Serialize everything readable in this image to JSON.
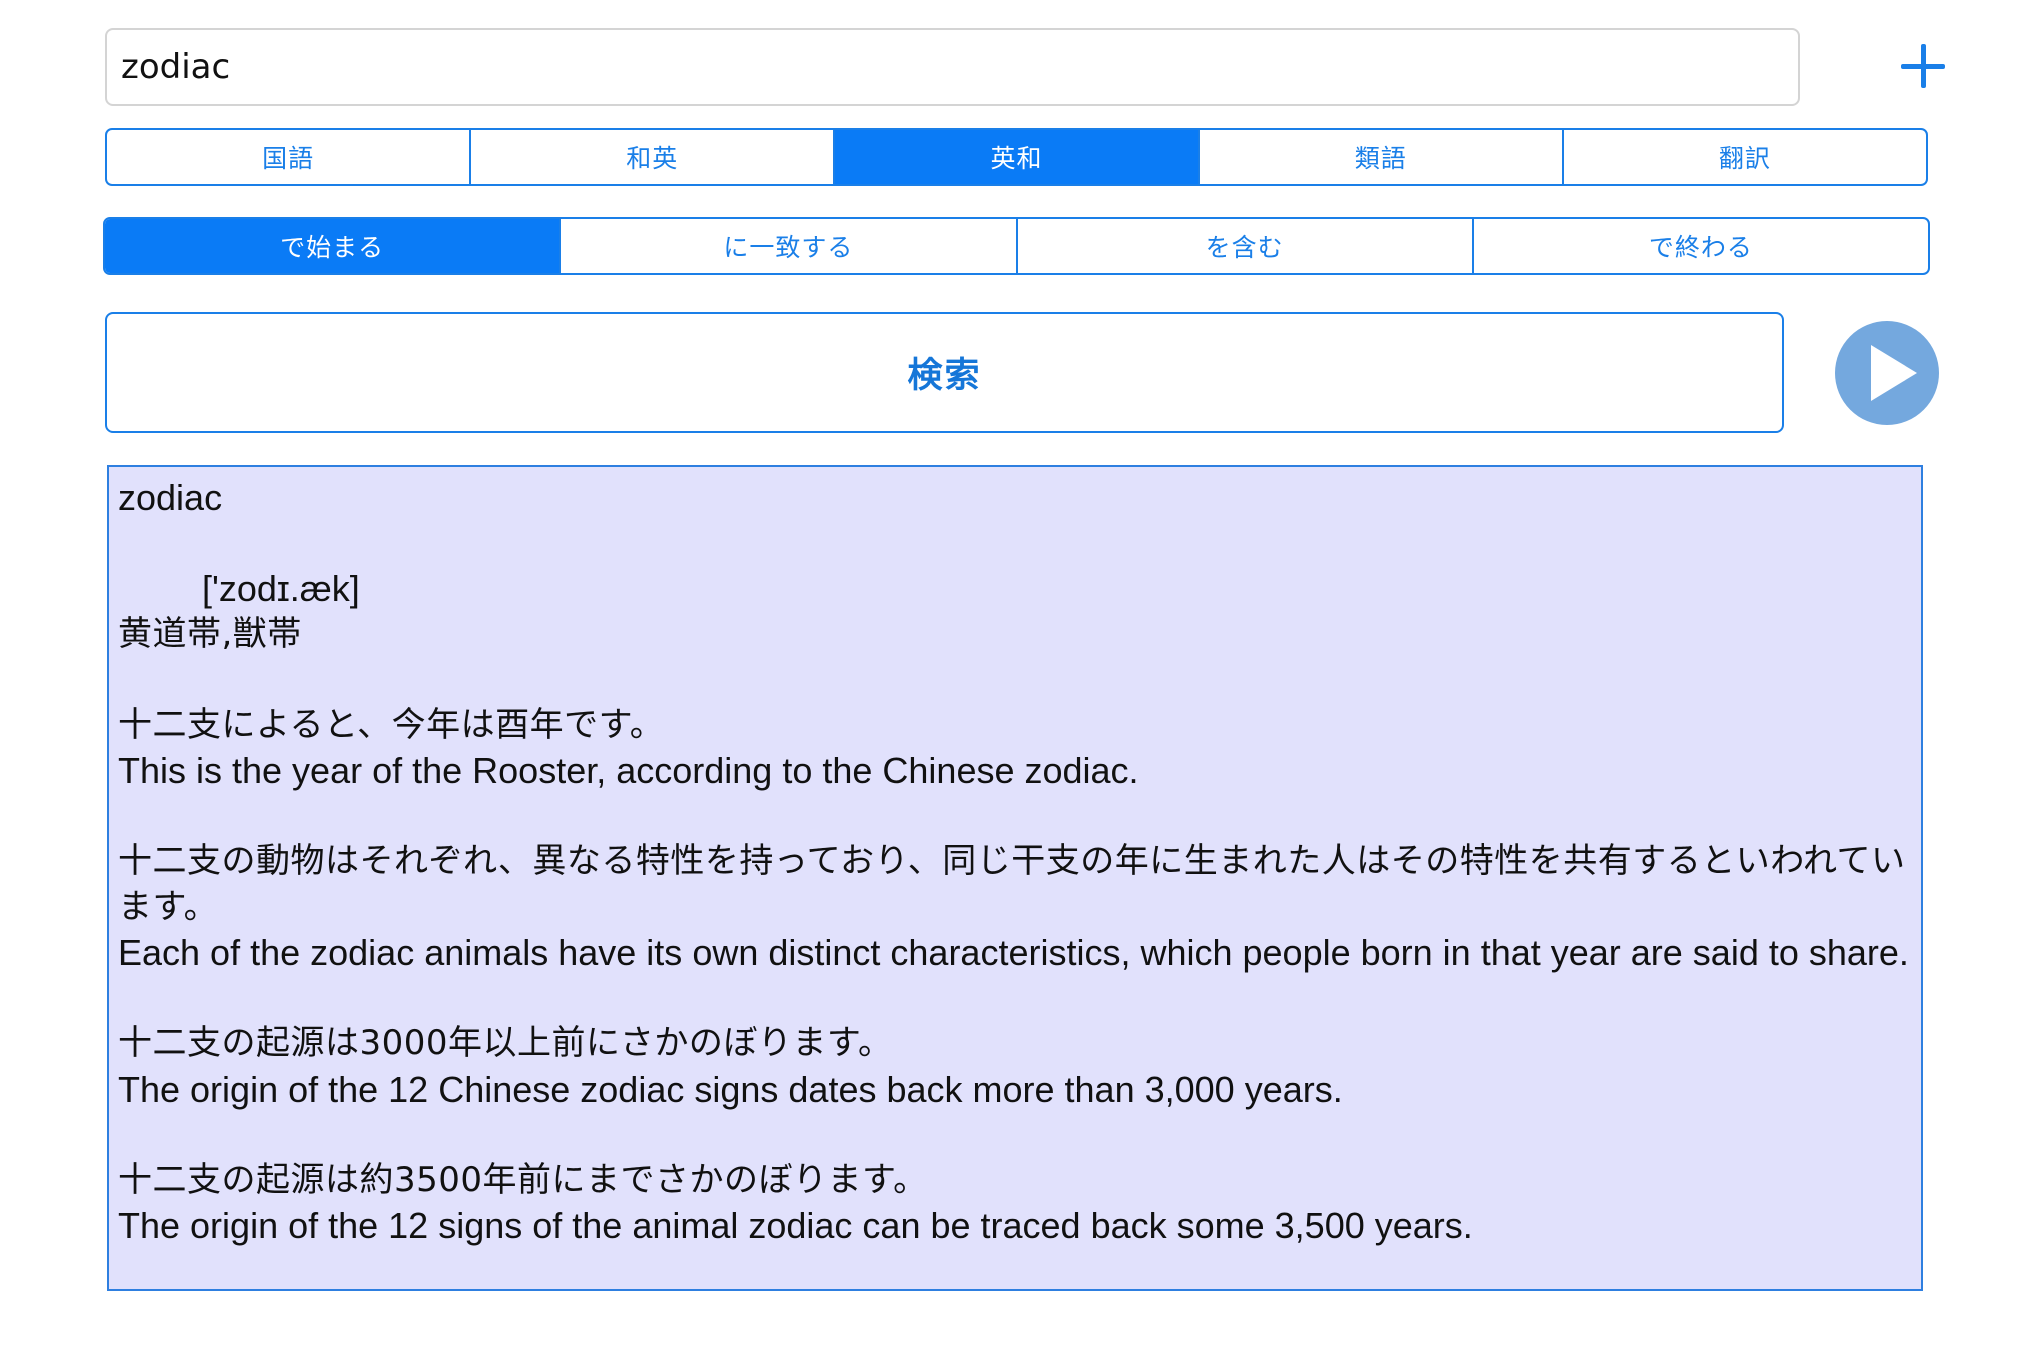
{
  "search": {
    "value": "zodiac",
    "add_icon": "plus-icon"
  },
  "dictionary_tabs": [
    {
      "label": "国語",
      "selected": false
    },
    {
      "label": "和英",
      "selected": false
    },
    {
      "label": "英和",
      "selected": true
    },
    {
      "label": "類語",
      "selected": false
    },
    {
      "label": "翻訳",
      "selected": false
    }
  ],
  "match_tabs": [
    {
      "label": "で始まる",
      "selected": true
    },
    {
      "label": "に一致する",
      "selected": false
    },
    {
      "label": "を含む",
      "selected": false
    },
    {
      "label": "で終わる",
      "selected": false
    }
  ],
  "search_button": {
    "label": "検索"
  },
  "play_button": {
    "icon": "play-icon"
  },
  "result": {
    "headword": "zodiac",
    "pronunciation": "['zodɪ.æk]",
    "meaning": " 黄道帯,獣帯",
    "examples": [
      {
        "ja": "十二支によると、今年は酉年です。",
        "en": "This is the year of the Rooster, according to the Chinese zodiac."
      },
      {
        "ja": "十二支の動物はそれぞれ、異なる特性を持っており、同じ干支の年に生まれた人はその特性を共有するといわれています。",
        "en": "Each of the zodiac animals have its own distinct characteristics, which people born in that year are said to share."
      },
      {
        "ja": "十二支の起源は3000年以上前にさかのぼります。",
        "en": "The origin of the 12 Chinese zodiac signs dates back more than 3,000 years."
      },
      {
        "ja": "十二支の起源は約3500年前にまでさかのぼります。",
        "en": "The origin of the 12 signs of the animal zodiac can be traced back some 3,500 years."
      }
    ]
  },
  "colors": {
    "accent": "#0a7bf6",
    "panel_background": "#e1e1fc",
    "play_button": "#74a8de"
  }
}
